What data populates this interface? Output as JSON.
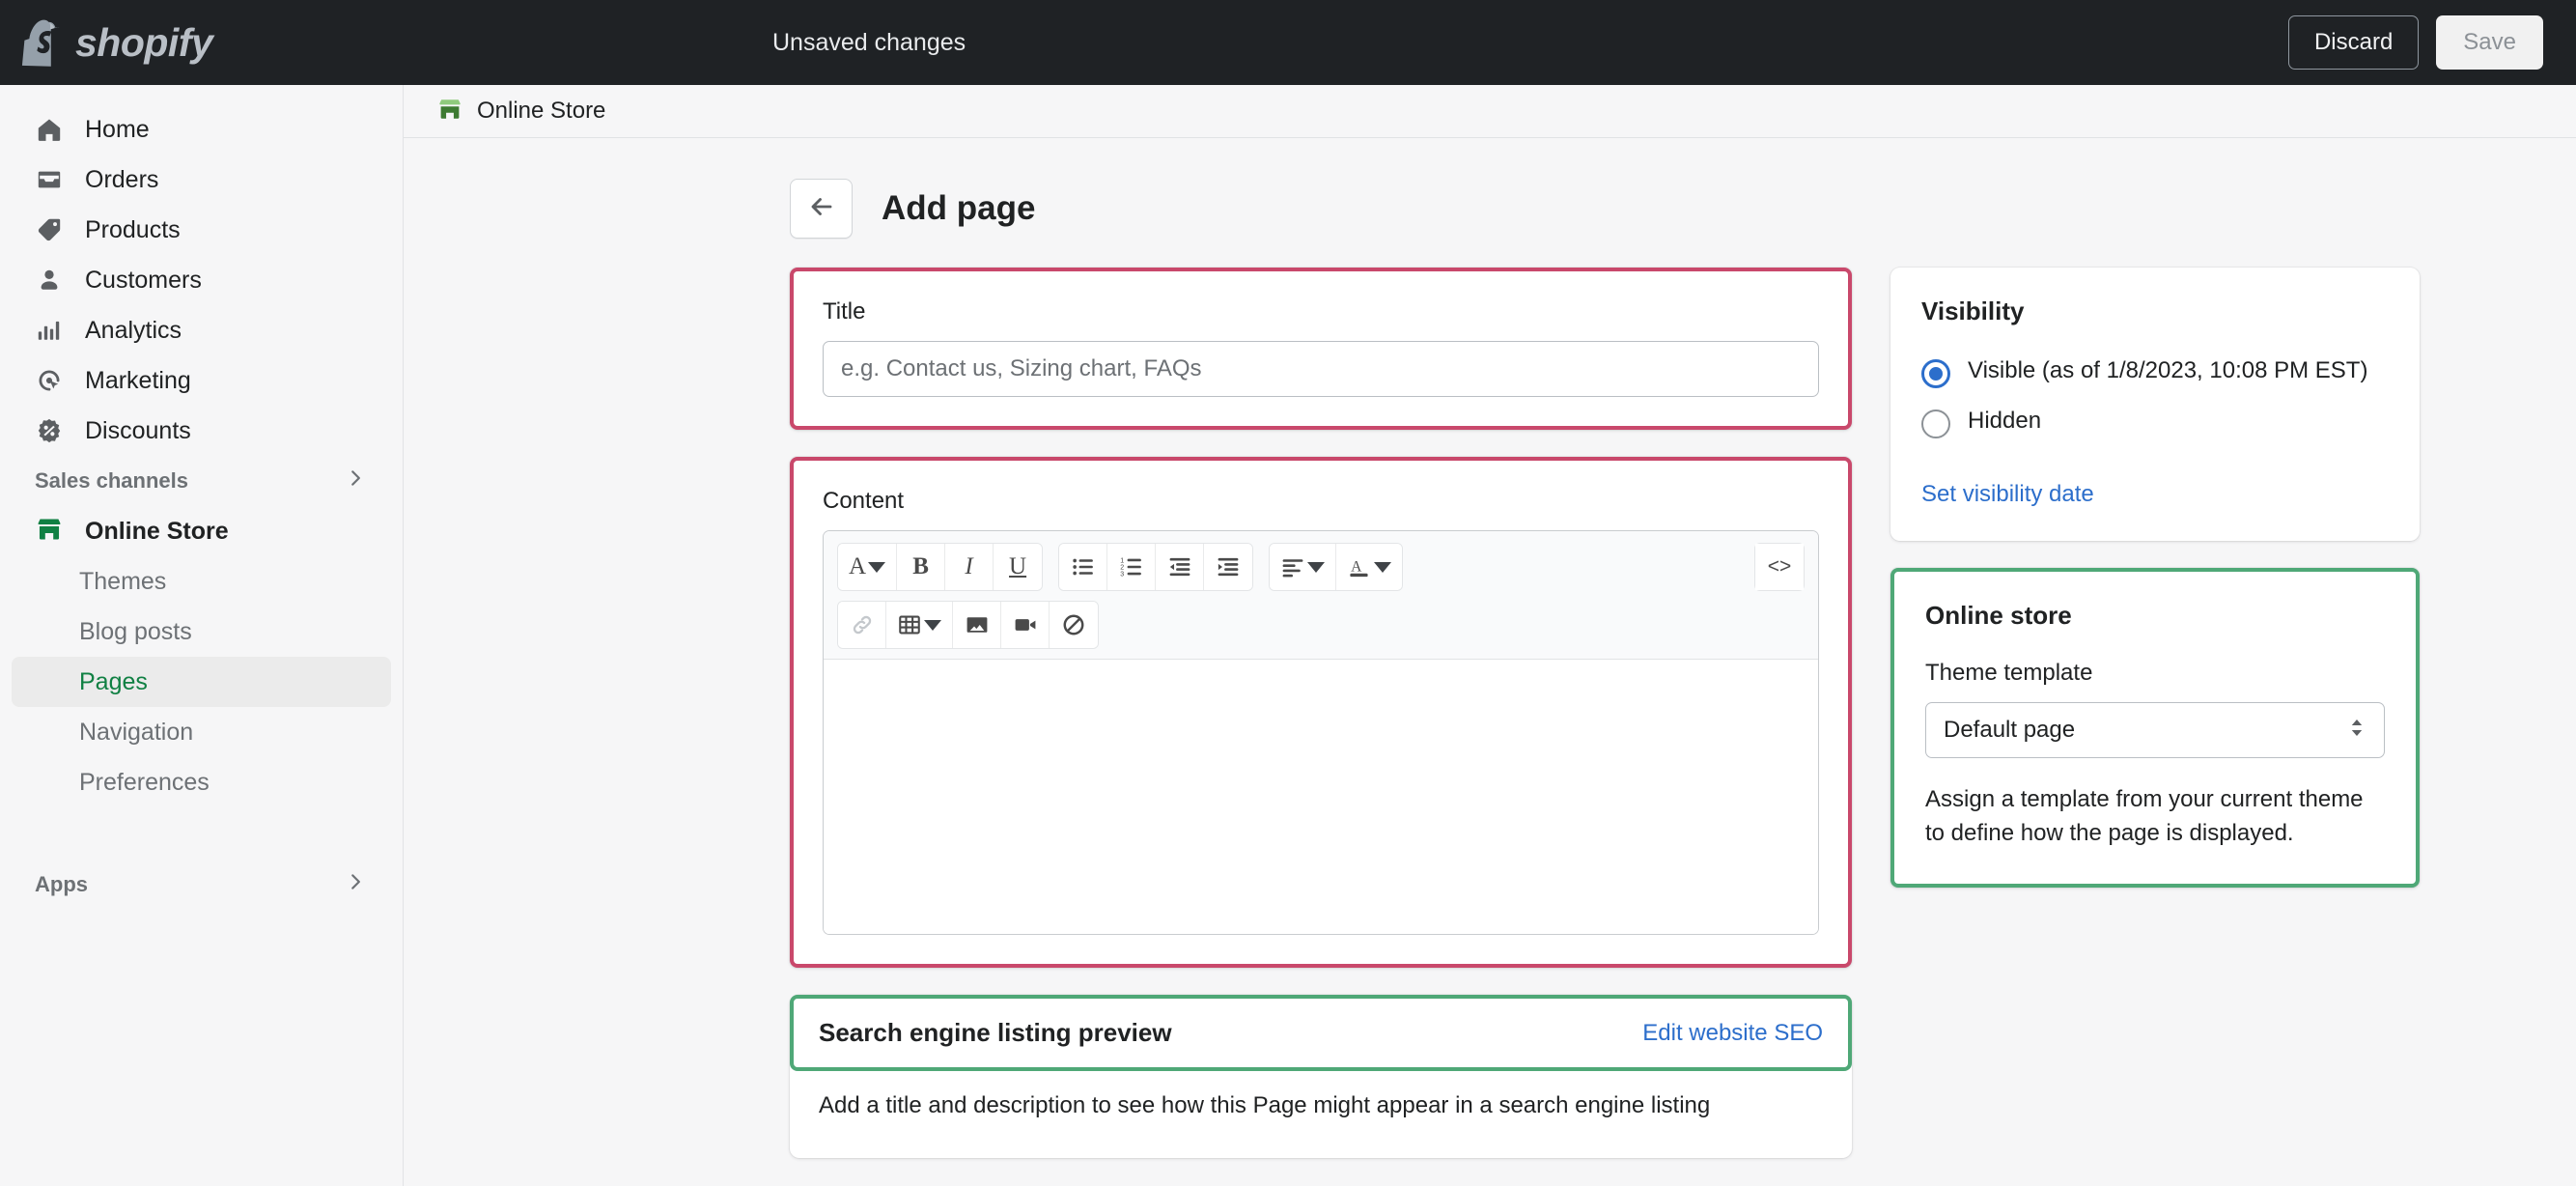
{
  "topbar": {
    "brand": "shopify",
    "status_text": "Unsaved changes",
    "discard_label": "Discard",
    "save_label": "Save"
  },
  "sidebar": {
    "items": [
      {
        "label": "Home",
        "icon": "home-icon"
      },
      {
        "label": "Orders",
        "icon": "orders-icon"
      },
      {
        "label": "Products",
        "icon": "products-tag-icon"
      },
      {
        "label": "Customers",
        "icon": "customers-person-icon"
      },
      {
        "label": "Analytics",
        "icon": "analytics-bars-icon"
      },
      {
        "label": "Marketing",
        "icon": "marketing-target-icon"
      },
      {
        "label": "Discounts",
        "icon": "discounts-percent-icon"
      }
    ],
    "sales_channels_label": "Sales channels",
    "online_store_label": "Online Store",
    "sub_items": [
      {
        "label": "Themes",
        "active": false
      },
      {
        "label": "Blog posts",
        "active": false
      },
      {
        "label": "Pages",
        "active": true
      },
      {
        "label": "Navigation",
        "active": false
      },
      {
        "label": "Preferences",
        "active": false
      }
    ],
    "apps_label": "Apps"
  },
  "breadcrumb": {
    "label": "Online Store",
    "icon": "storefront-icon"
  },
  "page": {
    "title": "Add page",
    "back_icon": "arrow-left-icon"
  },
  "title_card": {
    "label": "Title",
    "value": "",
    "placeholder": "e.g. Contact us, Sizing chart, FAQs",
    "highlight": "#c9486b"
  },
  "content_card": {
    "label": "Content",
    "highlight": "#c9486b",
    "toolbar_row1": [
      {
        "name": "format-style-button",
        "glyph": "A",
        "caret": true,
        "disabled": false
      },
      {
        "name": "bold-button",
        "glyph": "B",
        "caret": false,
        "disabled": false
      },
      {
        "name": "italic-button",
        "glyph": "I",
        "caret": false,
        "disabled": false
      },
      {
        "name": "underline-button",
        "glyph": "U",
        "caret": false,
        "disabled": false
      }
    ],
    "toolbar_lists": [
      {
        "name": "bulleted-list-button"
      },
      {
        "name": "numbered-list-button"
      },
      {
        "name": "outdent-button"
      },
      {
        "name": "indent-button"
      }
    ],
    "toolbar_align": [
      {
        "name": "align-button",
        "caret": true
      },
      {
        "name": "text-color-button",
        "caret": true
      }
    ],
    "code_button": {
      "name": "html-code-button",
      "glyph": "<>"
    },
    "toolbar_row2": [
      {
        "name": "link-button",
        "disabled": true
      },
      {
        "name": "table-button",
        "caret": true,
        "disabled": false
      },
      {
        "name": "insert-image-button",
        "disabled": false
      },
      {
        "name": "insert-video-button",
        "disabled": false
      },
      {
        "name": "clear-formatting-button",
        "disabled": false
      }
    ],
    "body_value": ""
  },
  "seo_card": {
    "title": "Search engine listing preview",
    "edit_link": "Edit website SEO",
    "description": "Add a title and description to see how this Page might appear in a search engine listing",
    "highlight": "#4fa877"
  },
  "visibility_card": {
    "title": "Visibility",
    "options": [
      {
        "label": "Visible (as of 1/8/2023, 10:08 PM EST)",
        "selected": true
      },
      {
        "label": "Hidden",
        "selected": false
      }
    ],
    "link": "Set visibility date",
    "accent": "#2c6ecb"
  },
  "online_store_card": {
    "title": "Online store",
    "field_label": "Theme template",
    "selected_template": "Default page",
    "help": "Assign a template from your current theme to define how the page is displayed.",
    "highlight": "#4fa877"
  }
}
